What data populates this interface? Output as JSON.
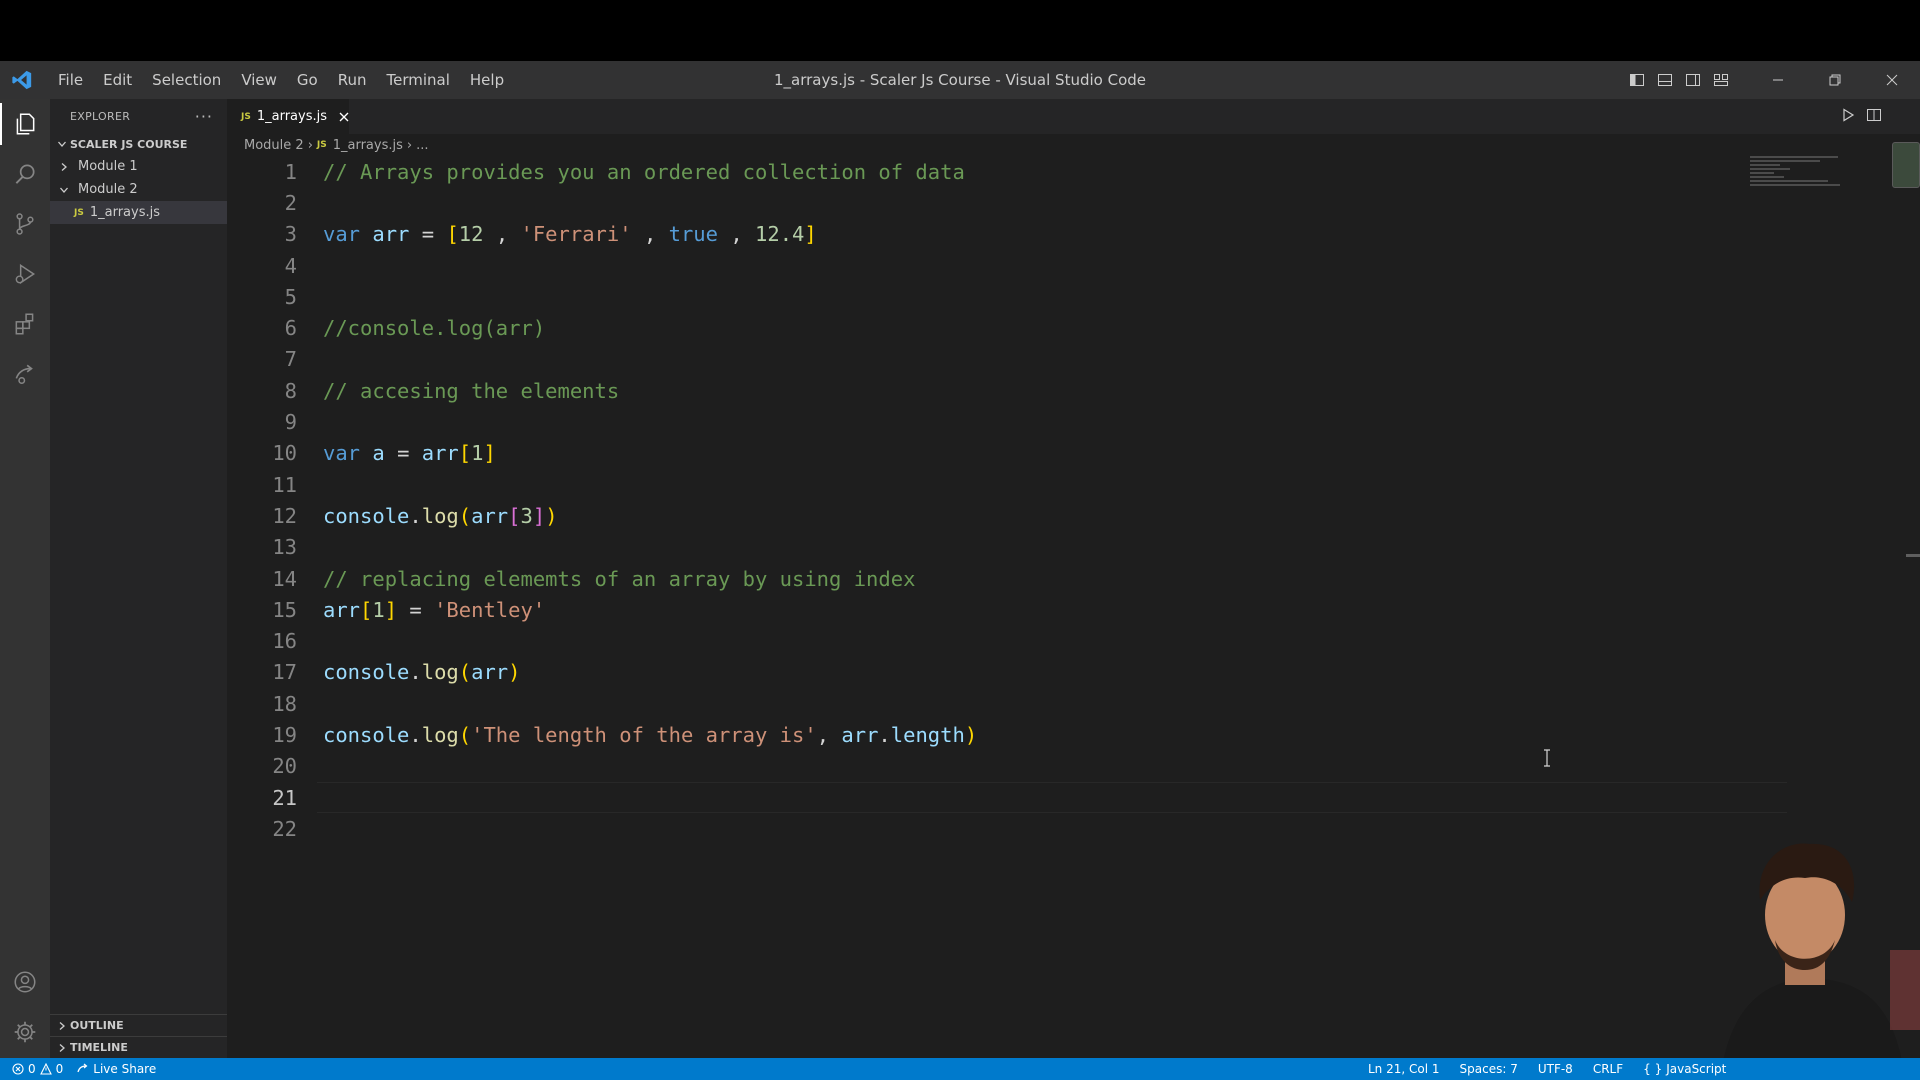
{
  "window": {
    "title": "1_arrays.js - Scaler Js Course - Visual Studio Code"
  },
  "menu": [
    "File",
    "Edit",
    "Selection",
    "View",
    "Go",
    "Run",
    "Terminal",
    "Help"
  ],
  "sidebar": {
    "header": "EXPLORER",
    "more_label": "···",
    "workspace": "SCALER JS COURSE",
    "tree": [
      {
        "label": "Module 1",
        "expanded": false
      },
      {
        "label": "Module 2",
        "expanded": true
      },
      {
        "label": "1_arrays.js",
        "badge": "JS",
        "selected": true
      }
    ],
    "outline": "OUTLINE",
    "timeline": "TIMELINE"
  },
  "tab": {
    "badge": "JS",
    "label": "1_arrays.js"
  },
  "breadcrumb": {
    "folder": "Module 2",
    "badge": "JS",
    "file": "1_arrays.js",
    "more": "..."
  },
  "editor": {
    "line_numbers": [
      "1",
      "2",
      "3",
      "4",
      "5",
      "6",
      "7",
      "8",
      "9",
      "10",
      "11",
      "12",
      "13",
      "14",
      "15",
      "16",
      "17",
      "18",
      "19",
      "20",
      "21",
      "22"
    ],
    "current_line": 21
  },
  "statusbar": {
    "errors": "0",
    "warnings": "0",
    "live_share": "Live Share",
    "position": "Ln 21, Col 1",
    "spaces": "Spaces: 7",
    "encoding": "UTF-8",
    "eol": "CRLF",
    "language": "JavaScript"
  },
  "colors": {
    "statusbar": "#007acc",
    "editor_bg": "#1e1e1e",
    "sidebar_bg": "#252526",
    "activitybar_bg": "#333333",
    "comment": "#6a9955",
    "keyword": "#569cd6",
    "string": "#ce9178"
  }
}
